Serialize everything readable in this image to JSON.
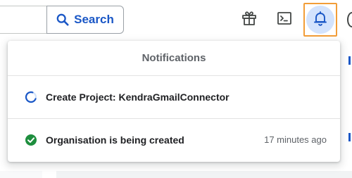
{
  "header": {
    "search_button_label": "Search"
  },
  "icons": {
    "search": "search-icon",
    "gift": "gift-icon",
    "terminal": "terminal-icon",
    "bell": "bell-icon",
    "in_progress": "spinner-icon",
    "done": "check-circle-icon"
  },
  "notifications": {
    "title": "Notifications",
    "items": [
      {
        "label": "Create Project: KendraGmailConnector",
        "status": "in-progress",
        "time": ""
      },
      {
        "label": "Organisation is being created",
        "status": "complete",
        "time": "17 minutes ago"
      }
    ]
  },
  "colors": {
    "accent_blue": "#1a57c6",
    "bell_active_bg": "#d3e3fd",
    "highlight_orange": "#f29d38",
    "success_green": "#1e8e3e"
  }
}
